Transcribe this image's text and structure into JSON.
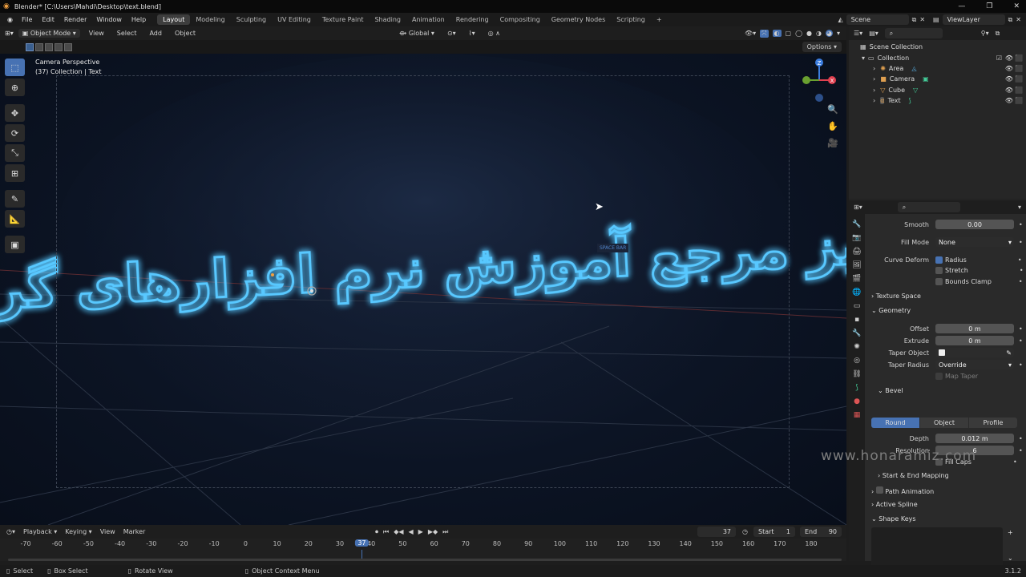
{
  "window": {
    "title": "Blender* [C:\\Users\\Mahdi\\Desktop\\text.blend]",
    "minimize": "—",
    "maximize": "❐",
    "close": "✕"
  },
  "menu": [
    "File",
    "Edit",
    "Render",
    "Window",
    "Help"
  ],
  "workspaces": [
    "Layout",
    "Modeling",
    "Sculpting",
    "UV Editing",
    "Texture Paint",
    "Shading",
    "Animation",
    "Rendering",
    "Compositing",
    "Geometry Nodes",
    "Scripting"
  ],
  "active_workspace": "Layout",
  "scene": {
    "name": "Scene",
    "view_layer": "ViewLayer"
  },
  "viewport_header": {
    "mode": "Object Mode",
    "view": "View",
    "select": "Select",
    "add": "Add",
    "object": "Object",
    "orientation": "Global",
    "options": "Options"
  },
  "viewport": {
    "line1": "Camera Perspective",
    "line2": "(37) Collection | Text",
    "neon_text": "هنر آمیز مرجع آموزش نرم افزارهای گرافیکی",
    "spacebar_hint": "SPACE BAR",
    "gizmo_axes": {
      "x": "X",
      "y": "Y",
      "z": "Z"
    }
  },
  "outliner": {
    "root": "Scene Collection",
    "collection": "Collection",
    "items": [
      "Area",
      "Camera",
      "Cube",
      "Text"
    ]
  },
  "properties": {
    "smooth_label": "Smooth",
    "smooth_value": "0.00",
    "fill_mode_label": "Fill Mode",
    "fill_mode_value": "None",
    "curve_deform_label": "Curve Deform",
    "radius": "Radius",
    "stretch": "Stretch",
    "bounds_clamp": "Bounds Clamp",
    "texture_space": "Texture Space",
    "geometry": "Geometry",
    "offset_label": "Offset",
    "offset_value": "0 m",
    "extrude_label": "Extrude",
    "extrude_value": "0 m",
    "taper_object_label": "Taper Object",
    "taper_radius_label": "Taper Radius",
    "taper_radius_value": "Override",
    "map_taper": "Map Taper",
    "bevel": "Bevel",
    "bevel_tabs": [
      "Round",
      "Object",
      "Profile"
    ],
    "depth_label": "Depth",
    "depth_value": "0.012 m",
    "resolution_label": "Resolution",
    "resolution_value": "6",
    "fill_caps": "Fill Caps",
    "start_end_mapping": "Start & End Mapping",
    "path_animation": "Path Animation",
    "active_spline": "Active Spline",
    "shape_keys": "Shape Keys"
  },
  "timeline": {
    "playback": "Playback",
    "keying": "Keying",
    "view": "View",
    "marker": "Marker",
    "current_frame": "37",
    "start_label": "Start",
    "start": "1",
    "end_label": "End",
    "end": "90",
    "ticks": [
      "-70",
      "-60",
      "-50",
      "-40",
      "-30",
      "-20",
      "-10",
      "0",
      "10",
      "20",
      "30",
      "40",
      "50",
      "60",
      "70",
      "80",
      "90",
      "100",
      "110",
      "120",
      "130",
      "140",
      "150",
      "160",
      "170",
      "180"
    ]
  },
  "status": {
    "select": "Select",
    "box_select": "Box Select",
    "rotate_view": "Rotate View",
    "context_menu": "Object Context Menu",
    "version": "3.1.2"
  },
  "watermark": "www.honaramiz.com",
  "colors": {
    "accent": "#4772b3",
    "neon": "#58c8ff",
    "viewport_bg": "#0c1424"
  }
}
